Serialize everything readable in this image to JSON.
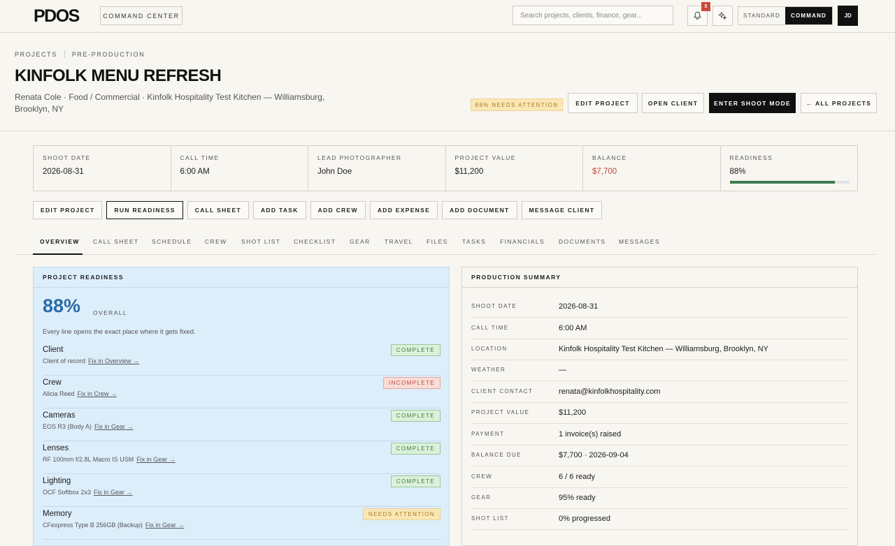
{
  "app": {
    "logo": "PDOS",
    "command_center": "COMMAND CENTER",
    "search_placeholder": "Search projects, clients, finance, gear...",
    "notification_count": "5",
    "mode_standard": "STANDARD",
    "mode_command": "COMMAND",
    "user_initials": "JD"
  },
  "header": {
    "breadcrumb": [
      "PROJECTS",
      "PRE-PRODUCTION"
    ],
    "title": "KINFOLK MENU REFRESH",
    "subtitle": "Renata Cole · Food / Commercial · Kinfolk Hospitality Test Kitchen — Williamsburg, Brooklyn, NY",
    "attention_badge": "88% NEEDS ATTENTION",
    "buttons": {
      "edit_project": "EDIT PROJECT",
      "open_client": "OPEN CLIENT",
      "enter_shoot_mode": "ENTER SHOOT MODE",
      "all_projects": "← ALL PROJECTS"
    }
  },
  "stats": [
    {
      "label": "SHOOT DATE",
      "value": "2026-08-31"
    },
    {
      "label": "CALL TIME",
      "value": "6:00 AM"
    },
    {
      "label": "LEAD PHOTOGRAPHER",
      "value": "John Doe"
    },
    {
      "label": "PROJECT VALUE",
      "value": "$11,200"
    },
    {
      "label": "BALANCE",
      "value": "$7,700"
    },
    {
      "label": "READINESS",
      "value": "88%"
    }
  ],
  "readiness_progress": 0.88,
  "actions": [
    "EDIT PROJECT",
    "RUN READINESS",
    "CALL SHEET",
    "ADD TASK",
    "ADD CREW",
    "ADD EXPENSE",
    "ADD DOCUMENT",
    "MESSAGE CLIENT"
  ],
  "tabs": [
    "OVERVIEW",
    "CALL SHEET",
    "SCHEDULE",
    "CREW",
    "SHOT LIST",
    "CHECKLIST",
    "GEAR",
    "TRAVEL",
    "FILES",
    "TASKS",
    "FINANCIALS",
    "DOCUMENTS",
    "MESSAGES"
  ],
  "readiness": {
    "heading": "PROJECT READINESS",
    "percent": "88%",
    "overall_label": "OVERALL",
    "note": "Every line opens the exact place where it gets fixed.",
    "items": [
      {
        "name": "Client",
        "detail": "Client of record",
        "link": "Fix in Overview →",
        "status": "COMPLETE"
      },
      {
        "name": "Crew",
        "detail": "Alicia Reed",
        "link": "Fix in Crew →",
        "status": "INCOMPLETE"
      },
      {
        "name": "Cameras",
        "detail": "EOS R3 (Body A)",
        "link": "Fix in Gear →",
        "status": "COMPLETE"
      },
      {
        "name": "Lenses",
        "detail": "RF 100mm f/2.8L Macro IS USM",
        "link": "Fix in Gear →",
        "status": "COMPLETE"
      },
      {
        "name": "Lighting",
        "detail": "OCF Softbox 2x3",
        "link": "Fix in Gear →",
        "status": "COMPLETE"
      },
      {
        "name": "Memory",
        "detail": "CFexpress Type B 256GB (Backup)",
        "link": "Fix in Gear →",
        "status": "NEEDS ATTENTION"
      }
    ]
  },
  "summary": {
    "heading": "PRODUCTION SUMMARY",
    "rows": [
      {
        "label": "SHOOT DATE",
        "value": "2026-08-31"
      },
      {
        "label": "CALL TIME",
        "value": "6:00 AM"
      },
      {
        "label": "LOCATION",
        "value": "Kinfolk Hospitality Test Kitchen — Williamsburg, Brooklyn, NY"
      },
      {
        "label": "WEATHER",
        "value": "—"
      },
      {
        "label": "CLIENT CONTACT",
        "value": "renata@kinfolkhospitality.com"
      },
      {
        "label": "PROJECT VALUE",
        "value": "$11,200"
      },
      {
        "label": "PAYMENT",
        "value": "1 invoice(s) raised"
      },
      {
        "label": "BALANCE DUE",
        "value": "$7,700 · 2026-09-04"
      },
      {
        "label": "CREW",
        "value": "6 / 6 ready"
      },
      {
        "label": "GEAR",
        "value": "95% ready"
      },
      {
        "label": "SHOT LIST",
        "value": "0% progressed"
      }
    ]
  },
  "colors": {
    "accent_blue": "#2b6ba8",
    "balance_red": "#c0473a",
    "progress_green": "#3f7a4f"
  }
}
